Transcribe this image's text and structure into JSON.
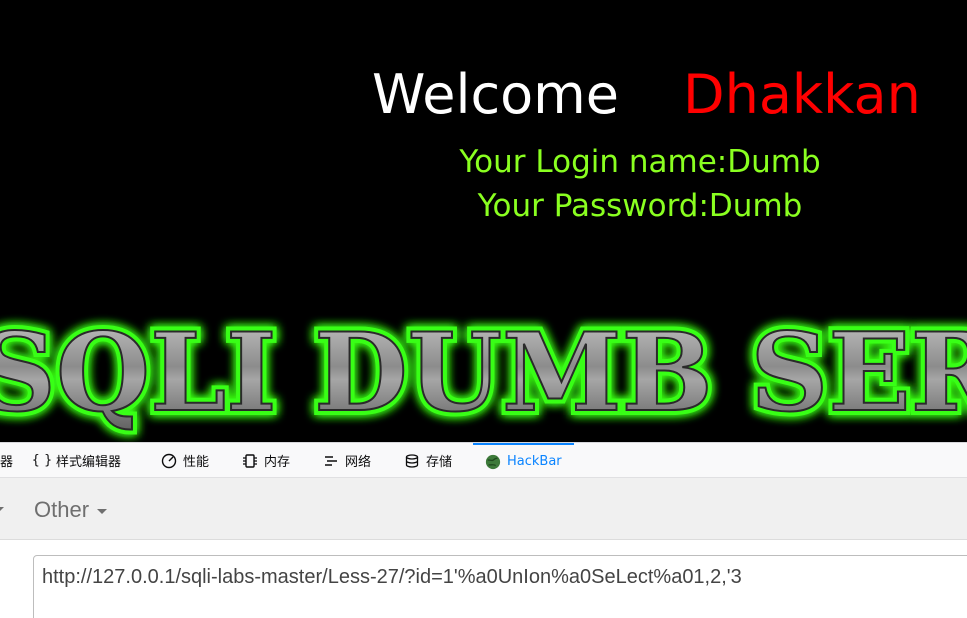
{
  "welcome": {
    "word": "Welcome",
    "name": "Dhakkan",
    "login_line": "Your Login name:Dumb",
    "password_line": "Your Password:Dumb"
  },
  "banner": {
    "text": "SQLI DUMB SERIES"
  },
  "devtools": {
    "tabs": [
      {
        "label": "器",
        "icon": "none"
      },
      {
        "label": "样式编辑器",
        "icon": "braces-icon"
      },
      {
        "label": "性能",
        "icon": "gauge-icon"
      },
      {
        "label": "内存",
        "icon": "memory-chip-icon"
      },
      {
        "label": "网络",
        "icon": "network-lines-icon"
      },
      {
        "label": "存储",
        "icon": "database-icon"
      },
      {
        "label": "HackBar",
        "icon": "hackbar-globe-icon"
      }
    ],
    "active_tab": "HackBar",
    "active_color": "#0a84ff"
  },
  "hackbar": {
    "menu_label": "Other",
    "url_value": "http://127.0.0.1/sqli-labs-master/Less-27/?id=1'%a0UnIon%a0SeLect%a01,2,'3"
  },
  "colors": {
    "welcome_word": "#ffffff",
    "welcome_name": "#ff0000",
    "info_text": "#8aff20",
    "banner_glow": "#39ff14"
  }
}
